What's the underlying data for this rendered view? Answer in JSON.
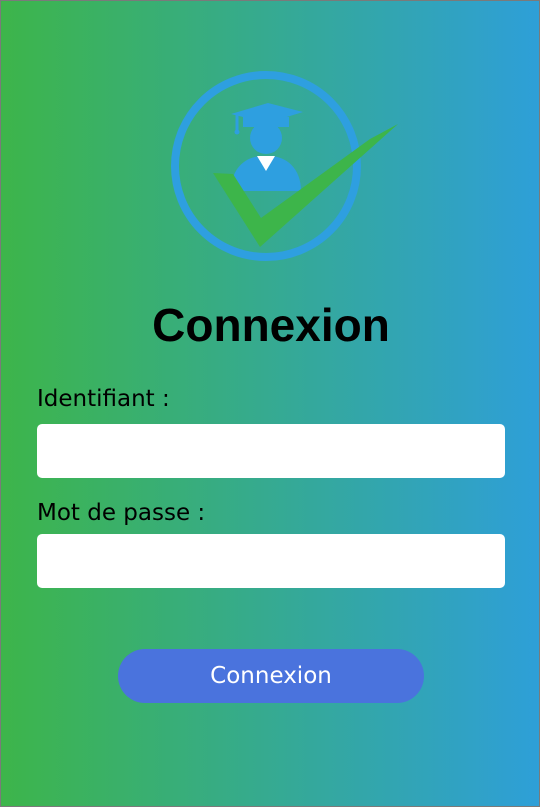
{
  "app": {
    "title": "Connexion"
  },
  "logo": {
    "icon": "graduate-checkmark-logo",
    "ring_color": "#2e9fe0",
    "check_color": "#3db54a"
  },
  "form": {
    "username": {
      "label": "Identifiant :",
      "value": "",
      "placeholder": ""
    },
    "password": {
      "label": "Mot de passe :",
      "value": "",
      "placeholder": ""
    },
    "submit_label": "Connexion"
  },
  "colors": {
    "gradient_start": "#3db54a",
    "gradient_end": "#2e9fd8",
    "button": "#4a73dd"
  }
}
